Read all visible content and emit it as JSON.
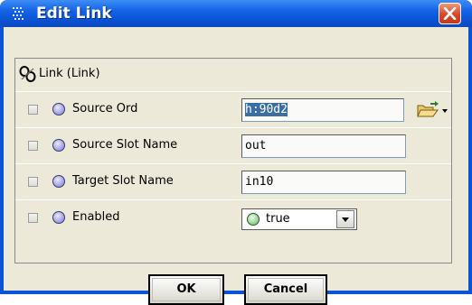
{
  "window": {
    "title": "Edit Link",
    "close_icon": "close-icon"
  },
  "panel": {
    "header": "Link  (Link)",
    "rows": [
      {
        "label": "Source Ord",
        "value": "h:90d2",
        "selected": true
      },
      {
        "label": "Source Slot Name",
        "value": "out"
      },
      {
        "label": "Target Slot Name",
        "value": "in10"
      },
      {
        "label": "Enabled",
        "value": "true",
        "control": "dropdown"
      }
    ]
  },
  "buttons": {
    "ok": "OK",
    "cancel": "Cancel"
  },
  "colors": {
    "titlebar": "#0a52d3",
    "close_button": "#d9472a",
    "dialog_background": "#ece9d8",
    "selection": "#3a6ea5",
    "status_true": "#8ccf8c"
  }
}
